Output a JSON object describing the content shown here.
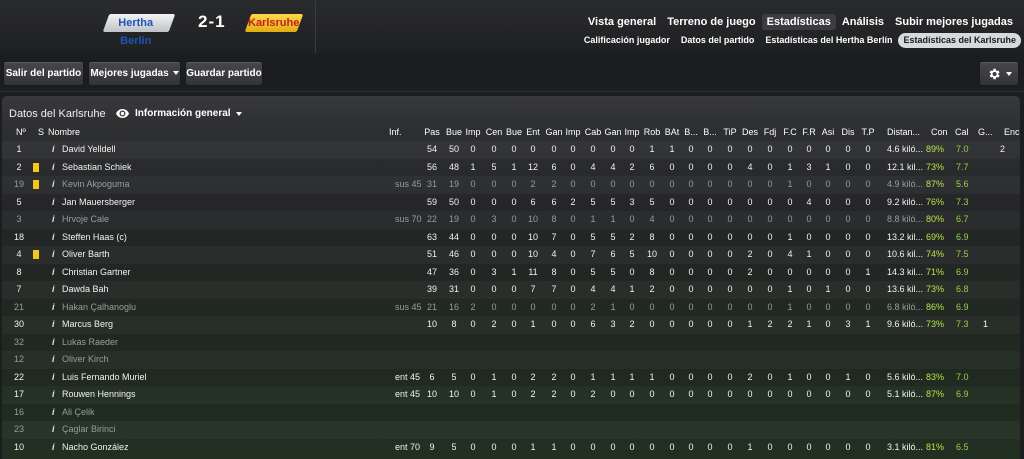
{
  "match": {
    "home_team": "Hertha Berlin",
    "away_team": "Karlsruhe",
    "score": "2-1",
    "home_color": "#1d55b8",
    "away_color": "#c32020"
  },
  "nav_tabs": [
    {
      "label": "Vista general",
      "active": false
    },
    {
      "label": "Terreno de juego",
      "active": false
    },
    {
      "label": "Estadísticas",
      "active": true
    },
    {
      "label": "Análisis",
      "active": false
    },
    {
      "label": "Subir mejores jugadas",
      "active": false
    }
  ],
  "sub_tabs": [
    {
      "label": "Calificación jugador",
      "active": false
    },
    {
      "label": "Datos del partido",
      "active": false
    },
    {
      "label": "Estadísticas del Hertha Berlín",
      "active": false
    },
    {
      "label": "Estadísticas del Karlsruhe",
      "active": true
    }
  ],
  "toolbar": {
    "exit_label": "Salir del partido",
    "highlights_label": "Mejores jugadas",
    "save_label": "Guardar partido",
    "settings_icon": "gear-icon"
  },
  "panel": {
    "title": "Datos del Karlsruhe",
    "view_label": "Información general",
    "view_icon": "eye-icon"
  },
  "columns": [
    "Nº",
    "S",
    "Nombre",
    "Inf.",
    "Pas",
    "Bue",
    "Imp",
    "Cen",
    "Bue",
    "Ent",
    "Gan",
    "Imp",
    "Cab",
    "Gan",
    "Imp",
    "Rob",
    "BAt",
    "B...",
    "B...",
    "TiP",
    "Des",
    "Fdj",
    "F.C",
    "F.R",
    "Asi",
    "Dis",
    "T.P",
    "Distan...",
    "Con",
    "Cal",
    "G...",
    "Enc"
  ],
  "players": [
    {
      "num": "1",
      "card": false,
      "dim": false,
      "name": "David Yelldell",
      "inf": "",
      "stats": [
        "54",
        "50",
        "0",
        "0",
        "0",
        "0",
        "0",
        "0",
        "0",
        "0",
        "0",
        "1",
        "1",
        "0",
        "0",
        "0",
        "0",
        "0",
        "0",
        "0",
        "0",
        "0",
        "0"
      ],
      "dist": "4.6 kiló...",
      "con": "89%",
      "cal": "7.0",
      "g": "",
      "enc": "2"
    },
    {
      "num": "2",
      "card": true,
      "dim": false,
      "name": "Sebastian Schiek",
      "inf": "",
      "stats": [
        "56",
        "48",
        "1",
        "5",
        "1",
        "12",
        "6",
        "0",
        "4",
        "4",
        "2",
        "6",
        "0",
        "0",
        "0",
        "0",
        "4",
        "0",
        "1",
        "3",
        "1",
        "0",
        "0"
      ],
      "dist": "12.1 kil...",
      "con": "73%",
      "cal": "7.7",
      "g": "",
      "enc": ""
    },
    {
      "num": "19",
      "card": true,
      "dim": true,
      "name": "Kevin Akpoguma",
      "inf": "sus 45",
      "stats": [
        "31",
        "19",
        "0",
        "0",
        "0",
        "2",
        "2",
        "0",
        "0",
        "0",
        "0",
        "0",
        "0",
        "0",
        "0",
        "0",
        "0",
        "0",
        "1",
        "0",
        "0",
        "0",
        "0"
      ],
      "dist": "4.9 kiló...",
      "con": "87%",
      "cal": "5.6",
      "g": "",
      "enc": ""
    },
    {
      "num": "5",
      "card": false,
      "dim": false,
      "name": "Jan Mauersberger",
      "inf": "",
      "stats": [
        "59",
        "50",
        "0",
        "0",
        "0",
        "6",
        "6",
        "2",
        "5",
        "5",
        "3",
        "5",
        "0",
        "0",
        "0",
        "0",
        "0",
        "0",
        "0",
        "4",
        "0",
        "0",
        "0"
      ],
      "dist": "9.2 kiló...",
      "con": "76%",
      "cal": "7.3",
      "g": "",
      "enc": ""
    },
    {
      "num": "3",
      "card": false,
      "dim": true,
      "name": "Hrvoje Cale",
      "inf": "sus 70",
      "stats": [
        "22",
        "19",
        "0",
        "3",
        "0",
        "10",
        "8",
        "0",
        "1",
        "1",
        "0",
        "4",
        "0",
        "0",
        "0",
        "0",
        "0",
        "0",
        "0",
        "0",
        "0",
        "0",
        "0"
      ],
      "dist": "8.8 kiló...",
      "con": "80%",
      "cal": "6.7",
      "g": "",
      "enc": ""
    },
    {
      "num": "18",
      "card": false,
      "dim": false,
      "name": "Steffen Haas (c)",
      "inf": "",
      "stats": [
        "63",
        "44",
        "0",
        "0",
        "0",
        "10",
        "7",
        "0",
        "5",
        "5",
        "2",
        "8",
        "0",
        "0",
        "0",
        "0",
        "0",
        "0",
        "1",
        "0",
        "0",
        "0",
        "0"
      ],
      "dist": "13.2 kil...",
      "con": "69%",
      "cal": "6.9",
      "g": "",
      "enc": ""
    },
    {
      "num": "4",
      "card": true,
      "dim": false,
      "name": "Oliver Barth",
      "inf": "",
      "stats": [
        "51",
        "46",
        "0",
        "0",
        "0",
        "10",
        "4",
        "0",
        "7",
        "6",
        "5",
        "10",
        "0",
        "0",
        "0",
        "0",
        "2",
        "0",
        "4",
        "1",
        "0",
        "0",
        "0"
      ],
      "dist": "10.6 kil...",
      "con": "74%",
      "cal": "7.5",
      "g": "",
      "enc": ""
    },
    {
      "num": "8",
      "card": false,
      "dim": false,
      "name": "Christian Gartner",
      "inf": "",
      "stats": [
        "47",
        "36",
        "0",
        "3",
        "1",
        "11",
        "8",
        "0",
        "5",
        "5",
        "0",
        "8",
        "0",
        "0",
        "0",
        "0",
        "2",
        "0",
        "0",
        "0",
        "0",
        "0",
        "1"
      ],
      "dist": "14.3 kil...",
      "con": "71%",
      "cal": "6.9",
      "g": "",
      "enc": ""
    },
    {
      "num": "7",
      "card": false,
      "dim": false,
      "name": "Dawda Bah",
      "inf": "",
      "stats": [
        "39",
        "31",
        "0",
        "0",
        "0",
        "7",
        "7",
        "0",
        "4",
        "4",
        "1",
        "2",
        "0",
        "0",
        "0",
        "0",
        "0",
        "0",
        "1",
        "0",
        "1",
        "0",
        "0"
      ],
      "dist": "13.6 kil...",
      "con": "73%",
      "cal": "6.8",
      "g": "",
      "enc": ""
    },
    {
      "num": "21",
      "card": false,
      "dim": true,
      "name": "Hakan Çalhanoglu",
      "inf": "sus 45",
      "stats": [
        "21",
        "16",
        "2",
        "0",
        "0",
        "0",
        "0",
        "0",
        "2",
        "1",
        "0",
        "0",
        "0",
        "0",
        "0",
        "0",
        "0",
        "0",
        "1",
        "0",
        "0",
        "0",
        "0"
      ],
      "dist": "6.8 kiló...",
      "con": "86%",
      "cal": "6.9",
      "g": "",
      "enc": ""
    },
    {
      "num": "30",
      "card": false,
      "dim": false,
      "name": "Marcus Berg",
      "inf": "",
      "stats": [
        "10",
        "8",
        "0",
        "2",
        "0",
        "1",
        "0",
        "0",
        "6",
        "3",
        "2",
        "0",
        "0",
        "0",
        "0",
        "0",
        "1",
        "2",
        "2",
        "1",
        "0",
        "3",
        "1"
      ],
      "dist": "9.6 kiló...",
      "con": "73%",
      "cal": "7.3",
      "g": "1",
      "enc": ""
    },
    {
      "num": "32",
      "card": false,
      "dim": true,
      "name": "Lukas Raeder",
      "inf": "",
      "stats": [],
      "dist": "",
      "con": "",
      "cal": "",
      "g": "",
      "enc": ""
    },
    {
      "num": "12",
      "card": false,
      "dim": true,
      "name": "Oliver Kirch",
      "inf": "",
      "stats": [],
      "dist": "",
      "con": "",
      "cal": "",
      "g": "",
      "enc": ""
    },
    {
      "num": "22",
      "card": false,
      "dim": false,
      "name": "Luis Fernando Muriel",
      "inf": "ent 45",
      "stats": [
        "6",
        "5",
        "0",
        "1",
        "0",
        "2",
        "2",
        "0",
        "1",
        "1",
        "1",
        "1",
        "0",
        "0",
        "0",
        "0",
        "2",
        "0",
        "1",
        "0",
        "0",
        "1",
        "0"
      ],
      "dist": "5.6 kiló...",
      "con": "83%",
      "cal": "7.0",
      "g": "",
      "enc": ""
    },
    {
      "num": "17",
      "card": false,
      "dim": false,
      "name": "Rouwen Hennings",
      "inf": "ent 45",
      "stats": [
        "10",
        "10",
        "0",
        "1",
        "0",
        "2",
        "2",
        "0",
        "2",
        "0",
        "0",
        "0",
        "0",
        "0",
        "0",
        "0",
        "0",
        "0",
        "0",
        "0",
        "0",
        "0",
        "0"
      ],
      "dist": "5.1 kiló...",
      "con": "87%",
      "cal": "6.9",
      "g": "",
      "enc": ""
    },
    {
      "num": "16",
      "card": false,
      "dim": true,
      "name": "Ali Çelik",
      "inf": "",
      "stats": [],
      "dist": "",
      "con": "",
      "cal": "",
      "g": "",
      "enc": ""
    },
    {
      "num": "23",
      "card": false,
      "dim": true,
      "name": "Çaglar Birinci",
      "inf": "",
      "stats": [],
      "dist": "",
      "con": "",
      "cal": "",
      "g": "",
      "enc": ""
    },
    {
      "num": "10",
      "card": false,
      "dim": false,
      "name": "Nacho González",
      "inf": "ent 70",
      "stats": [
        "9",
        "5",
        "0",
        "0",
        "0",
        "1",
        "1",
        "0",
        "0",
        "0",
        "0",
        "0",
        "0",
        "0",
        "0",
        "0",
        "1",
        "0",
        "0",
        "0",
        "0",
        "0",
        "0"
      ],
      "dist": "3.1 kiló...",
      "con": "81%",
      "cal": "6.5",
      "g": "",
      "enc": ""
    }
  ]
}
